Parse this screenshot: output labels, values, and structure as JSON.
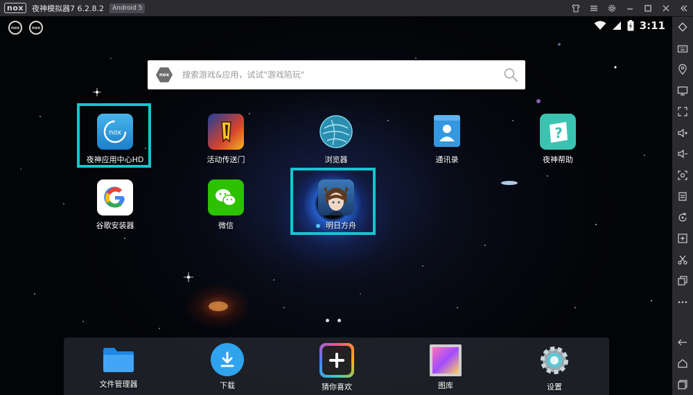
{
  "window": {
    "logo_text": "nox",
    "title": "夜神模拟器7 6.2.8.2",
    "android_badge": "Android 5"
  },
  "status_bar": {
    "time": "3:11"
  },
  "search": {
    "logo_text": "nox",
    "placeholder": "搜索游戏&应用，试试\"游戏陷玩\""
  },
  "apps": [
    {
      "label": "夜神应用中心HD",
      "icon": "nox-app-center-icon"
    },
    {
      "label": "活动传送门",
      "icon": "event-portal-icon"
    },
    {
      "label": "浏览器",
      "icon": "browser-globe-icon"
    },
    {
      "label": "通讯录",
      "icon": "contacts-icon"
    },
    {
      "label": "夜神帮助",
      "icon": "nox-help-icon"
    },
    {
      "label": "谷歌安装器",
      "icon": "google-installer-icon"
    },
    {
      "label": "微信",
      "icon": "wechat-icon"
    },
    {
      "label": "明日方舟",
      "icon": "arknights-icon"
    }
  ],
  "dock": [
    {
      "label": "文件管理器",
      "icon": "folder-icon"
    },
    {
      "label": "下载",
      "icon": "download-icon"
    },
    {
      "label": "猜你喜欢",
      "icon": "plus-icon"
    },
    {
      "label": "图库",
      "icon": "gallery-icon"
    },
    {
      "label": "设置",
      "icon": "settings-gear-icon"
    }
  ],
  "colors": {
    "highlight": "#16c6cf",
    "titlebar": "#2b2b30"
  }
}
